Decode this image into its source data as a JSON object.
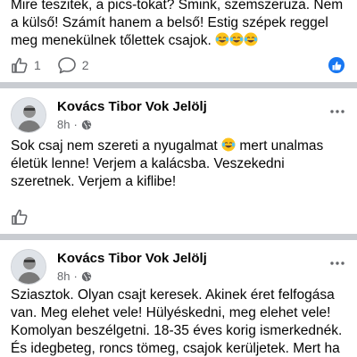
{
  "posts": [
    {
      "lines": [
        "Mire teszitek, a pics-tokat? Smink, szemszeruza. Nem",
        "a külső! Számít hanem a belső! Estig szépek reggel",
        "meg menekülnek tőlettek csajok."
      ],
      "likes": "1",
      "comments": "2"
    },
    {
      "author": "Kovács Tibor Vok Jelölj",
      "time": "8h",
      "lines": [
        "Sok csaj nem szereti a nyugalmat",
        "mert unalmas",
        "életük lenne! Verjem a kalácsba. Veszekedni",
        "szeretnek. Verjem a kiflibe!"
      ]
    },
    {
      "author": "Kovács Tibor Vok Jelölj",
      "time": "8h",
      "lines": [
        "Sziasztok. Olyan csajt keresek. Akinek éret felfogása",
        "van. Meg elehet vele! Hülyéskedni, meg elehet vele!",
        "Komolyan beszélgetni. 18-35 éves korig ismerkednék.",
        "És idegbeteg, roncs tömeg, csajok kerüljetek. Mert ha"
      ]
    }
  ],
  "icons": {
    "like": "thumbs-up-icon",
    "comment": "speech-bubble-icon",
    "share": "share-icon",
    "globe": "globe-icon",
    "more": "more-icon",
    "emoji": "tears-of-joy-emoji"
  },
  "colors": {
    "accent": "#1877f2",
    "secondary_text": "#65676b",
    "separator": "#c9ccd1"
  }
}
